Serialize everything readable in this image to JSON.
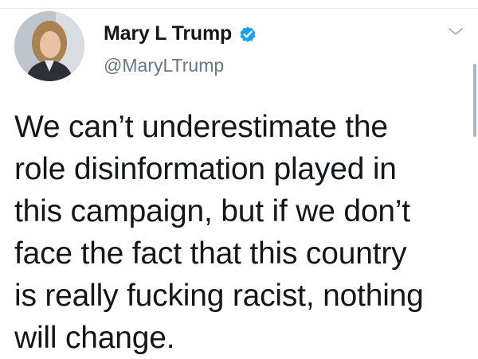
{
  "tweet": {
    "author": {
      "display_name": "Mary L Trump",
      "handle": "@MaryLTrump",
      "verified": true,
      "avatar_icon": "profile-photo"
    },
    "text_lines": [
      "We can’t underestimate the",
      "role disinformation played in",
      "this campaign, but if we don’t",
      "face the fact that this country",
      "is really fucking racist, nothing",
      "will change."
    ],
    "menu_icon": "chevron-down-icon"
  },
  "colors": {
    "text": "#14171a",
    "secondary": "#657786",
    "verified_blue": "#1da1f2",
    "background": "#ffffff"
  }
}
